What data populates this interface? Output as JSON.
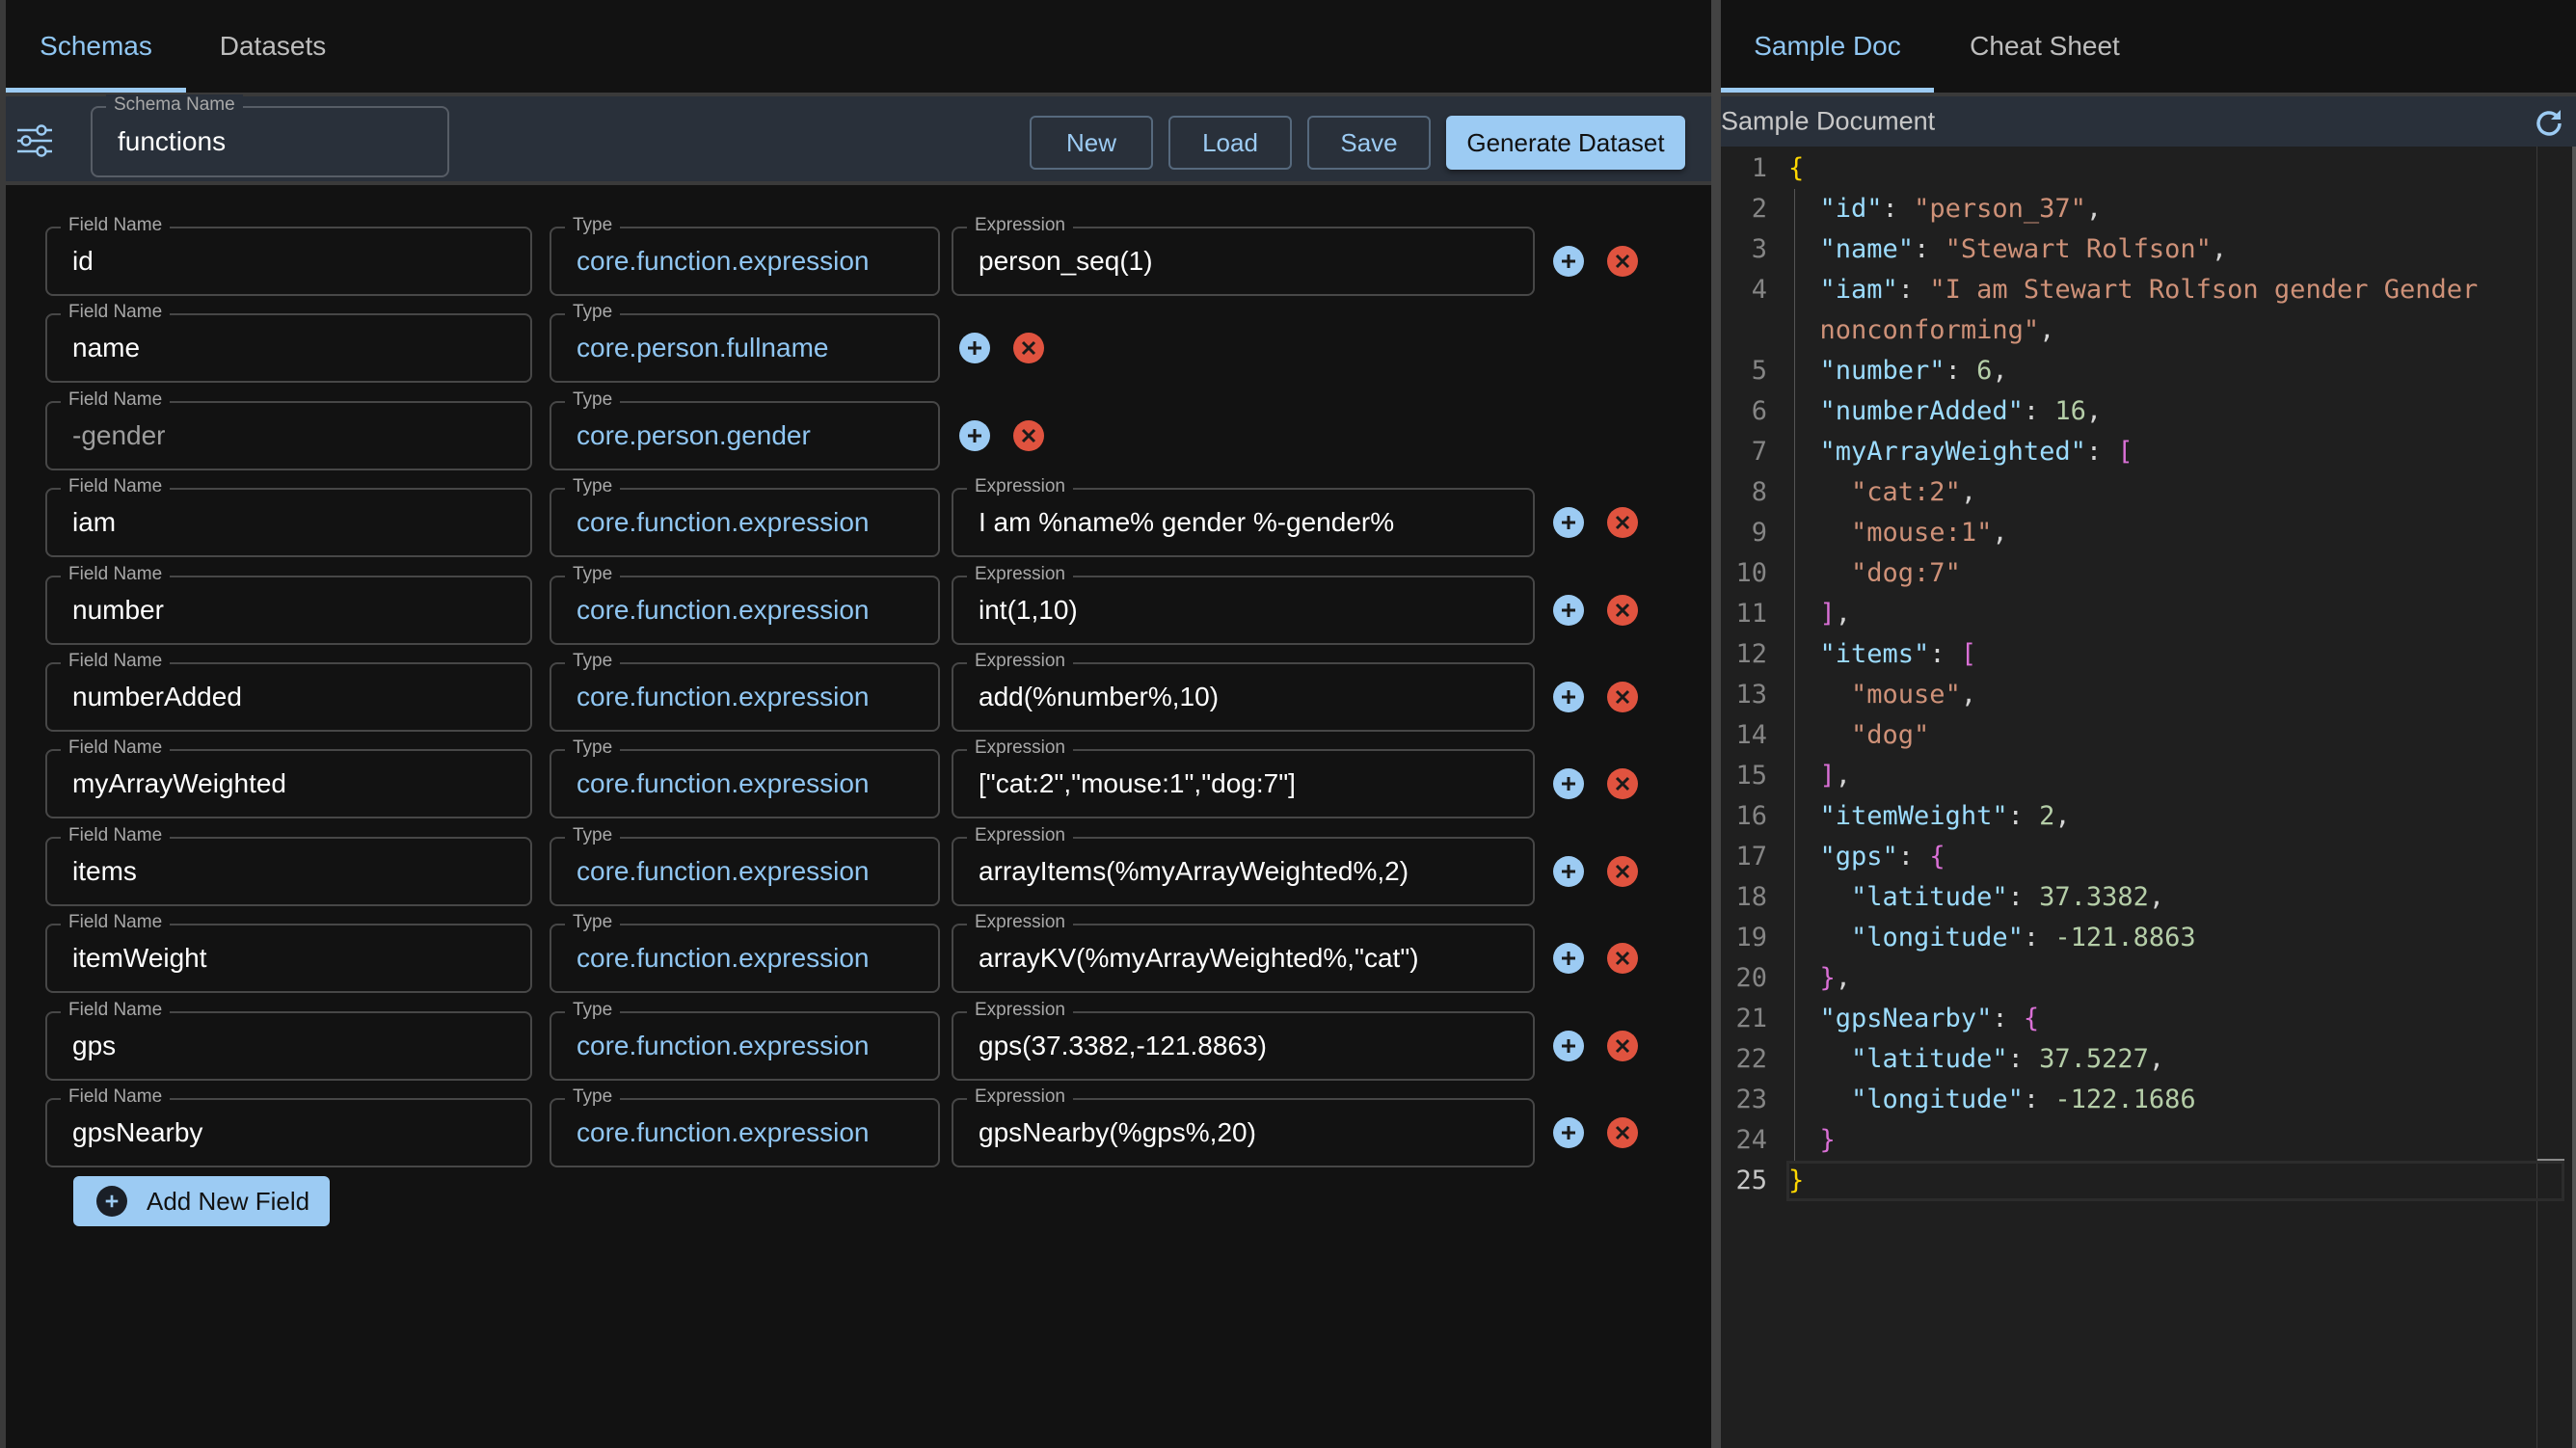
{
  "left_tabs": [
    {
      "label": "Schemas",
      "active": true
    },
    {
      "label": "Datasets",
      "active": false
    }
  ],
  "toolbar": {
    "settings_icon": "sliders-icon",
    "schema_name_label": "Schema Name",
    "schema_name_value": "functions",
    "new_label": "New",
    "load_label": "Load",
    "save_label": "Save",
    "generate_label": "Generate Dataset"
  },
  "field_labels": {
    "name": "Field Name",
    "type": "Type",
    "expression": "Expression"
  },
  "fields": [
    {
      "name": "id",
      "type": "core.function.expression",
      "expression": "person_seq(1)",
      "dim": false
    },
    {
      "name": "name",
      "type": "core.person.fullname",
      "expression": null,
      "dim": false
    },
    {
      "name": "-gender",
      "type": "core.person.gender",
      "expression": null,
      "dim": true
    },
    {
      "name": "iam",
      "type": "core.function.expression",
      "expression": "I am %name% gender %-gender%",
      "dim": false
    },
    {
      "name": "number",
      "type": "core.function.expression",
      "expression": "int(1,10)",
      "dim": false
    },
    {
      "name": "numberAdded",
      "type": "core.function.expression",
      "expression": "add(%number%,10)",
      "dim": false
    },
    {
      "name": "myArrayWeighted",
      "type": "core.function.expression",
      "expression": "[\"cat:2\",\"mouse:1\",\"dog:7\"]",
      "dim": false
    },
    {
      "name": "items",
      "type": "core.function.expression",
      "expression": "arrayItems(%myArrayWeighted%,2)",
      "dim": false
    },
    {
      "name": "itemWeight",
      "type": "core.function.expression",
      "expression": "arrayKV(%myArrayWeighted%,\"cat\")",
      "dim": false
    },
    {
      "name": "gps",
      "type": "core.function.expression",
      "expression": "gps(37.3382,-121.8863)",
      "dim": false
    },
    {
      "name": "gpsNearby",
      "type": "core.function.expression",
      "expression": "gpsNearby(%gps%,20)",
      "dim": false
    }
  ],
  "add_field_label": "Add New Field",
  "right_tabs": [
    {
      "label": "Sample Doc",
      "active": true
    },
    {
      "label": "Cheat Sheet",
      "active": false
    }
  ],
  "sample_header": "Sample Document",
  "colors": {
    "accent": "#9ccbf3",
    "danger": "#e0533f",
    "key": "#9cdcfe",
    "string": "#ce9178",
    "number": "#b5cea8"
  },
  "code_lines": [
    {
      "n": "1",
      "tokens": [
        [
          "b1",
          "{"
        ]
      ]
    },
    {
      "n": "2",
      "tokens": [
        [
          "p",
          "  "
        ],
        [
          "key",
          "\"id\""
        ],
        [
          "p",
          ": "
        ],
        [
          "str",
          "\"person_37\""
        ],
        [
          "p",
          ","
        ]
      ]
    },
    {
      "n": "3",
      "tokens": [
        [
          "p",
          "  "
        ],
        [
          "key",
          "\"name\""
        ],
        [
          "p",
          ": "
        ],
        [
          "str",
          "\"Stewart Rolfson\""
        ],
        [
          "p",
          ","
        ]
      ]
    },
    {
      "n": "4",
      "tokens": [
        [
          "p",
          "  "
        ],
        [
          "key",
          "\"iam\""
        ],
        [
          "p",
          ": "
        ],
        [
          "str",
          "\"I am Stewart Rolfson gender Gender"
        ]
      ]
    },
    {
      "n": "",
      "tokens": [
        [
          "p",
          "  "
        ],
        [
          "str",
          "nonconforming\""
        ],
        [
          "p",
          ","
        ]
      ]
    },
    {
      "n": "5",
      "tokens": [
        [
          "p",
          "  "
        ],
        [
          "key",
          "\"number\""
        ],
        [
          "p",
          ": "
        ],
        [
          "num",
          "6"
        ],
        [
          "p",
          ","
        ]
      ]
    },
    {
      "n": "6",
      "tokens": [
        [
          "p",
          "  "
        ],
        [
          "key",
          "\"numberAdded\""
        ],
        [
          "p",
          ": "
        ],
        [
          "num",
          "16"
        ],
        [
          "p",
          ","
        ]
      ]
    },
    {
      "n": "7",
      "tokens": [
        [
          "p",
          "  "
        ],
        [
          "key",
          "\"myArrayWeighted\""
        ],
        [
          "p",
          ": "
        ],
        [
          "b2",
          "["
        ]
      ]
    },
    {
      "n": "8",
      "tokens": [
        [
          "p",
          "    "
        ],
        [
          "str",
          "\"cat:2\""
        ],
        [
          "p",
          ","
        ]
      ]
    },
    {
      "n": "9",
      "tokens": [
        [
          "p",
          "    "
        ],
        [
          "str",
          "\"mouse:1\""
        ],
        [
          "p",
          ","
        ]
      ]
    },
    {
      "n": "10",
      "tokens": [
        [
          "p",
          "    "
        ],
        [
          "str",
          "\"dog:7\""
        ]
      ]
    },
    {
      "n": "11",
      "tokens": [
        [
          "p",
          "  "
        ],
        [
          "b2",
          "]"
        ],
        [
          "p",
          ","
        ]
      ]
    },
    {
      "n": "12",
      "tokens": [
        [
          "p",
          "  "
        ],
        [
          "key",
          "\"items\""
        ],
        [
          "p",
          ": "
        ],
        [
          "b2",
          "["
        ]
      ]
    },
    {
      "n": "13",
      "tokens": [
        [
          "p",
          "    "
        ],
        [
          "str",
          "\"mouse\""
        ],
        [
          "p",
          ","
        ]
      ]
    },
    {
      "n": "14",
      "tokens": [
        [
          "p",
          "    "
        ],
        [
          "str",
          "\"dog\""
        ]
      ]
    },
    {
      "n": "15",
      "tokens": [
        [
          "p",
          "  "
        ],
        [
          "b2",
          "]"
        ],
        [
          "p",
          ","
        ]
      ]
    },
    {
      "n": "16",
      "tokens": [
        [
          "p",
          "  "
        ],
        [
          "key",
          "\"itemWeight\""
        ],
        [
          "p",
          ": "
        ],
        [
          "num",
          "2"
        ],
        [
          "p",
          ","
        ]
      ]
    },
    {
      "n": "17",
      "tokens": [
        [
          "p",
          "  "
        ],
        [
          "key",
          "\"gps\""
        ],
        [
          "p",
          ": "
        ],
        [
          "b2",
          "{"
        ]
      ]
    },
    {
      "n": "18",
      "tokens": [
        [
          "p",
          "    "
        ],
        [
          "key",
          "\"latitude\""
        ],
        [
          "p",
          ": "
        ],
        [
          "num",
          "37.3382"
        ],
        [
          "p",
          ","
        ]
      ]
    },
    {
      "n": "19",
      "tokens": [
        [
          "p",
          "    "
        ],
        [
          "key",
          "\"longitude\""
        ],
        [
          "p",
          ": "
        ],
        [
          "num",
          "-121.8863"
        ]
      ]
    },
    {
      "n": "20",
      "tokens": [
        [
          "p",
          "  "
        ],
        [
          "b2",
          "}"
        ],
        [
          "p",
          ","
        ]
      ]
    },
    {
      "n": "21",
      "tokens": [
        [
          "p",
          "  "
        ],
        [
          "key",
          "\"gpsNearby\""
        ],
        [
          "p",
          ": "
        ],
        [
          "b2",
          "{"
        ]
      ]
    },
    {
      "n": "22",
      "tokens": [
        [
          "p",
          "    "
        ],
        [
          "key",
          "\"latitude\""
        ],
        [
          "p",
          ": "
        ],
        [
          "num",
          "37.5227"
        ],
        [
          "p",
          ","
        ]
      ]
    },
    {
      "n": "23",
      "tokens": [
        [
          "p",
          "    "
        ],
        [
          "key",
          "\"longitude\""
        ],
        [
          "p",
          ": "
        ],
        [
          "num",
          "-122.1686"
        ]
      ]
    },
    {
      "n": "24",
      "tokens": [
        [
          "p",
          "  "
        ],
        [
          "b2",
          "}"
        ]
      ]
    },
    {
      "n": "25",
      "tokens": [
        [
          "b1",
          "}"
        ]
      ],
      "current": true
    }
  ]
}
